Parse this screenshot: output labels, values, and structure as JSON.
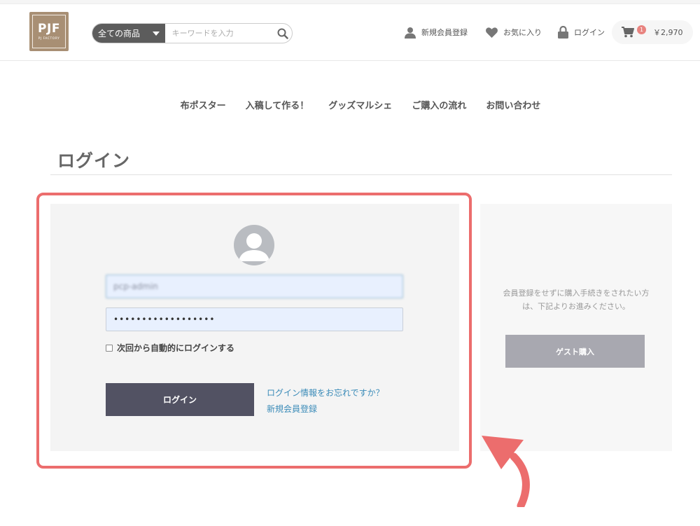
{
  "header": {
    "logo_text": "PJF",
    "logo_sub": "PJ FACTORY",
    "search": {
      "category": "全ての商品",
      "placeholder": "キーワードを入力"
    },
    "nav": {
      "register": "新規会員登録",
      "favorites": "お気に入り",
      "login": "ログイン"
    },
    "cart": {
      "count": "1",
      "total": "￥2,970"
    }
  },
  "main_nav": [
    "布ポスター",
    "入稿して作る！",
    "グッズマルシェ",
    "ご購入の流れ",
    "お問い合わせ"
  ],
  "page_title": "ログイン",
  "login_form": {
    "username_value": "pcp-admin",
    "password_value": "••••••••••••••••••",
    "remember_label": "次回から自動的にログインする",
    "login_button": "ログイン",
    "forgot_link": "ログイン情報をお忘れですか？",
    "register_link": "新規会員登録"
  },
  "guest": {
    "description": "会員登録をせずに購入手続きをされたい方は、下記よりお進みください。",
    "button": "ゲスト購入"
  },
  "colors": {
    "highlight": "#ec6d6d",
    "button_dark": "#525263",
    "link": "#3a8bb8",
    "logo_bg": "#a88f74"
  }
}
